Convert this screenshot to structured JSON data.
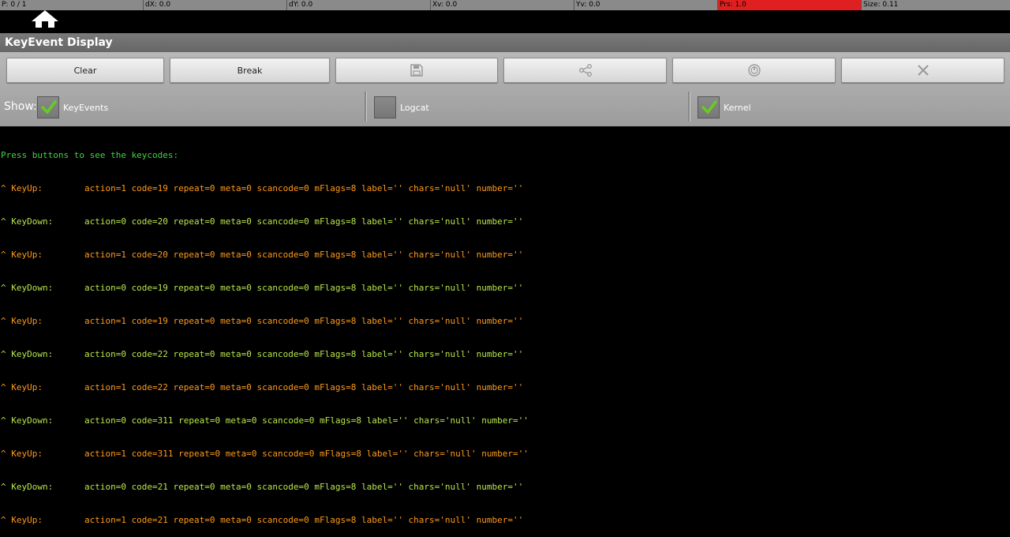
{
  "pointer_bar": {
    "p": "P: 0 / 1",
    "dx": "dX: 0.0",
    "dy": "dY: 0.0",
    "xv": "Xv: 0.0",
    "yv": "Yv: 0.0",
    "prs": "Prs: 1.0",
    "size": "Size: 0.11"
  },
  "app": {
    "title": "KeyEvent Display"
  },
  "toolbar": {
    "clear_label": "Clear",
    "break_label": "Break",
    "save_icon": "save-icon",
    "share_icon": "share-icon",
    "power_icon": "power-icon",
    "close_icon": "close-icon"
  },
  "show": {
    "label": "Show:",
    "options": [
      {
        "label": "KeyEvents",
        "checked": true
      },
      {
        "label": "Logcat",
        "checked": false
      },
      {
        "label": "Kernel",
        "checked": true
      }
    ]
  },
  "colors": {
    "header_text": "#3fd63f",
    "keyup": "#ff9a1a",
    "keydown": "#b8e64a",
    "check": "#66cc22"
  },
  "log": {
    "header": "Press buttons to see the keycodes:",
    "lines": [
      {
        "text": "^ KeyUp:        action=1 code=19 repeat=0 meta=0 scancode=0 mFlags=8 label='' chars='null' number=''",
        "kind": "keyup"
      },
      {
        "text": "^ KeyDown:      action=0 code=20 repeat=0 meta=0 scancode=0 mFlags=8 label='' chars='null' number=''",
        "kind": "keydown"
      },
      {
        "text": "^ KeyUp:        action=1 code=20 repeat=0 meta=0 scancode=0 mFlags=8 label='' chars='null' number=''",
        "kind": "keyup"
      },
      {
        "text": "^ KeyDown:      action=0 code=19 repeat=0 meta=0 scancode=0 mFlags=8 label='' chars='null' number=''",
        "kind": "keydown"
      },
      {
        "text": "^ KeyUp:        action=1 code=19 repeat=0 meta=0 scancode=0 mFlags=8 label='' chars='null' number=''",
        "kind": "keyup"
      },
      {
        "text": "^ KeyDown:      action=0 code=22 repeat=0 meta=0 scancode=0 mFlags=8 label='' chars='null' number=''",
        "kind": "keydown"
      },
      {
        "text": "^ KeyUp:        action=1 code=22 repeat=0 meta=0 scancode=0 mFlags=8 label='' chars='null' number=''",
        "kind": "keyup"
      },
      {
        "text": "^ KeyDown:      action=0 code=311 repeat=0 meta=0 scancode=0 mFlags=8 label='' chars='null' number=''",
        "kind": "keydown"
      },
      {
        "text": "^ KeyUp:        action=1 code=311 repeat=0 meta=0 scancode=0 mFlags=8 label='' chars='null' number=''",
        "kind": "keyup"
      },
      {
        "text": "^ KeyDown:      action=0 code=21 repeat=0 meta=0 scancode=0 mFlags=8 label='' chars='null' number=''",
        "kind": "keydown"
      },
      {
        "text": "^ KeyUp:        action=1 code=21 repeat=0 meta=0 scancode=0 mFlags=8 label='' chars='null' number=''",
        "kind": "keyup"
      }
    ]
  }
}
